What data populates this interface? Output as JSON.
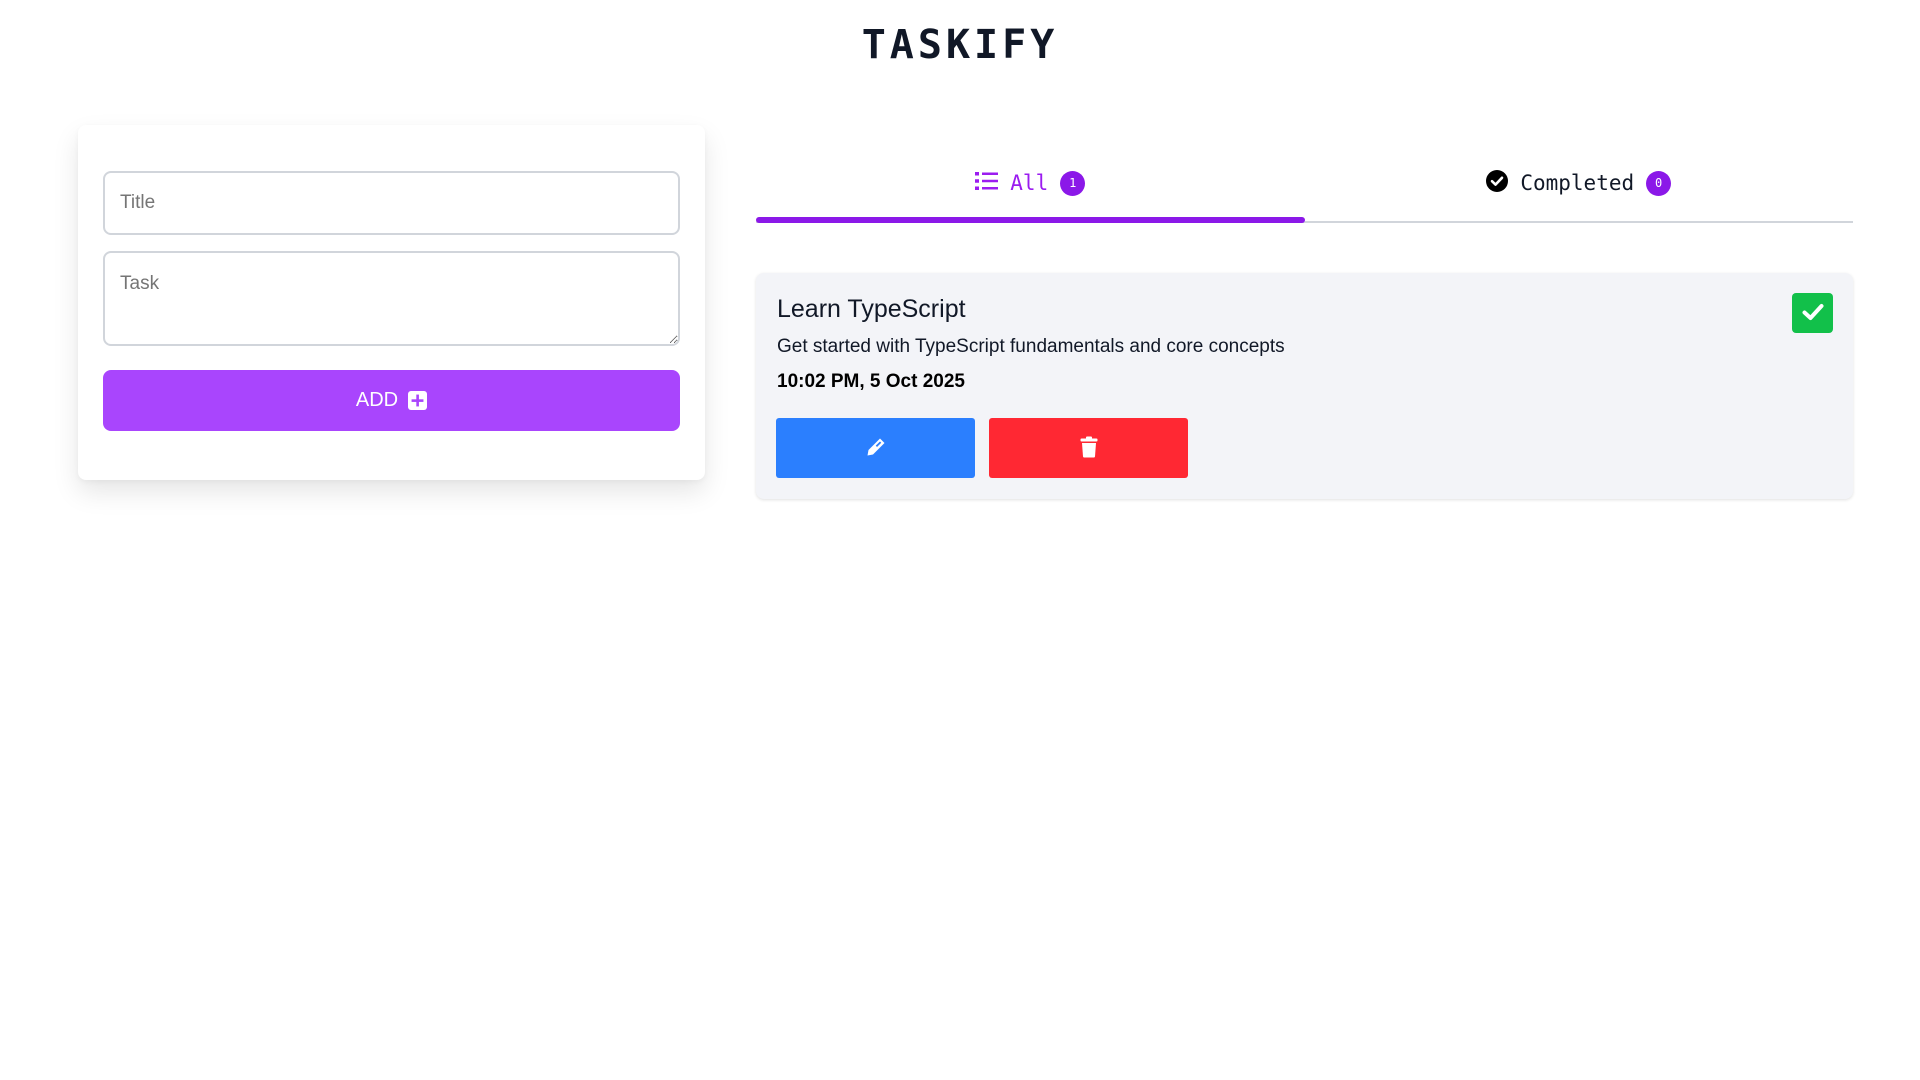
{
  "app": {
    "title": "TASKIFY"
  },
  "form": {
    "title_placeholder": "Title",
    "task_placeholder": "Task",
    "title_value": "",
    "task_value": "",
    "add_label": "ADD",
    "add_icon": "plus-square-icon"
  },
  "tabs": [
    {
      "label": "All",
      "count": "1",
      "icon": "list-icon",
      "active": true
    },
    {
      "label": "Completed",
      "count": "0",
      "icon": "check-circle-icon",
      "active": false
    }
  ],
  "tasks": [
    {
      "title": "Learn TypeScript",
      "description": "Get started with TypeScript fundamentals and core concepts",
      "timestamp": "10:02 PM, 5 Oct 2025",
      "completed": false
    }
  ],
  "colors": {
    "accent": "#8b18e8",
    "add_button": "#a945fd",
    "complete_button": "#12c04a",
    "edit_button": "#2b7ffe",
    "delete_button": "#ff2833",
    "card_background": "#f3f4f8"
  }
}
